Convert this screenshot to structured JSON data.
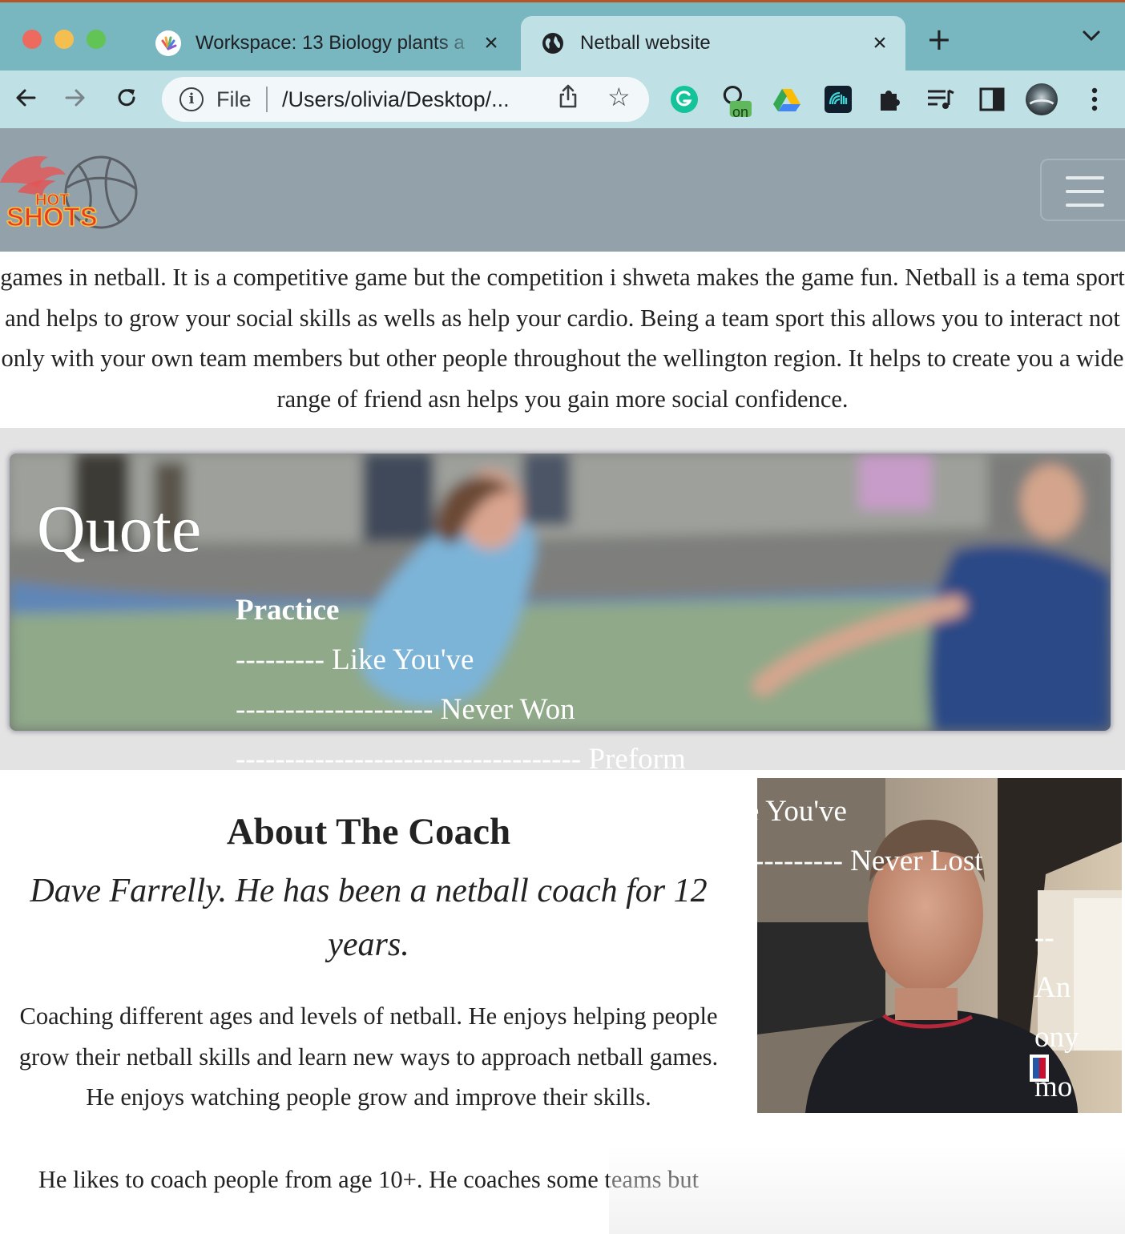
{
  "browser": {
    "tabs": [
      {
        "title": "Workspace: 13 Biology plants a",
        "active": false
      },
      {
        "title": "Netball website",
        "active": true
      }
    ],
    "address": {
      "scheme_label": "File",
      "url": "/Users/olivia/Desktop/..."
    },
    "extensions": [
      "grammarly-icon",
      "extension-on-icon",
      "google-drive-icon",
      "audio-extension-icon",
      "puzzle-icon",
      "reading-list-icon",
      "side-panel-icon",
      "profile-avatar"
    ],
    "extension_badge": "on",
    "colors": {
      "tabbar": "#78b6c0",
      "toolbar": "#bfe0e4"
    }
  },
  "site": {
    "logo_text": "HOT SHOTS",
    "nav_color": "#93a1ab",
    "intro_text": "games in netball. It is a competitive game but the competition i shweta makes the game fun. Netball is a tema sport and helps to grow your social skills as wells as help your cardio. Being a team sport this allows you to interact not only with your own team members but other people throughout the wellington region. It helps to create you a wide range of friend asn helps you gain more social confidence.",
    "quote": {
      "title": "Quote",
      "lines": [
        "Practice",
        "--------- Like You've",
        "-------------------- Never Won",
        "----------------------------------- Preform",
        "e You've",
        "--------- Never Lost",
        "--",
        "An",
        "ony",
        "mo"
      ]
    },
    "about": {
      "heading": "About The Coach",
      "subheading": "Dave Farrelly. He has been a netball coach for 12 years.",
      "paragraph1": "Coaching different ages and levels of netball. He enjoys helping people grow their netball skills and learn new ways to approach netball games. He enjoys watching people grow and improve their skills.",
      "paragraph2": "He likes to coach people from age 10+. He coaches some teams but"
    }
  }
}
